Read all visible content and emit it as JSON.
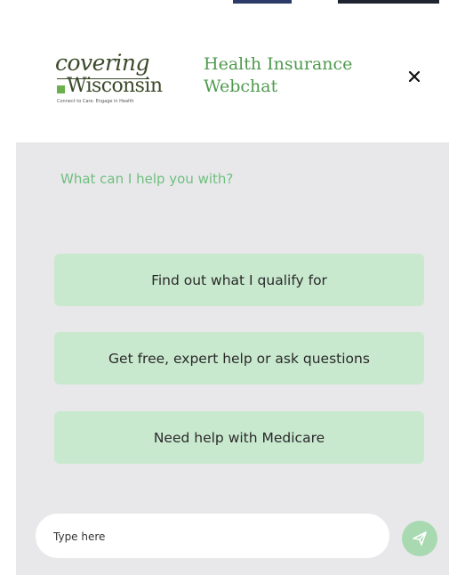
{
  "logo": {
    "line1": "covering",
    "line2": "Wisconsin",
    "tagline": "Connect to Care. Engage in Health"
  },
  "header": {
    "title": "Health Insurance\nWebchat",
    "close_icon": "close-icon"
  },
  "chat": {
    "prompt": "What can I help you with?",
    "options": [
      "Find out what I qualify for",
      "Get free, expert help or ask questions",
      "Need help with Medicare"
    ]
  },
  "composer": {
    "placeholder": "Type here",
    "send_icon": "send-icon"
  },
  "colors": {
    "accent": "#4e9a4e",
    "option_bg": "#c9e9cf",
    "panel_bg": "#e8e8ea",
    "send_bg": "#a9d9b1"
  }
}
